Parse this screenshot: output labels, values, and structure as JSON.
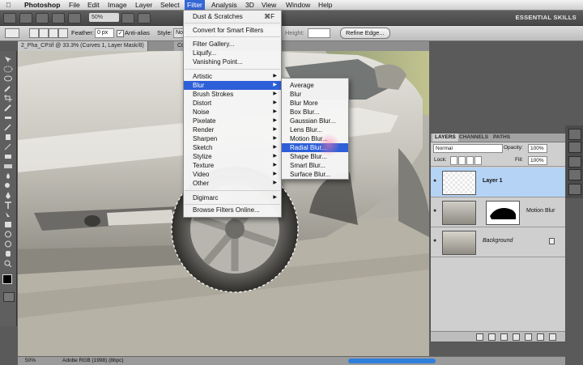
{
  "menubar": {
    "apple": "",
    "items": [
      "Photoshop",
      "File",
      "Edit",
      "Image",
      "Layer",
      "Select",
      "Filter",
      "Analysis",
      "3D",
      "View",
      "Window",
      "Help"
    ],
    "active": "Filter"
  },
  "appbar": {
    "zoom": "50%",
    "workspace": "ESSENTIAL SKILLS"
  },
  "options": {
    "feather_label": "Feather:",
    "feather_value": "0 px",
    "antialias_label": "Anti-alias",
    "antialias_check": "✓",
    "style_label": "Style:",
    "style_value": "Nor",
    "height_label": "Height:",
    "refine_edge": "Refine Edge..."
  },
  "document": {
    "tab_title": "2_Pha_CP.tif @ 33.3% (Curves 1, Layer Mask/8)",
    "tab2_title": "Cor"
  },
  "filter_menu": {
    "items": [
      {
        "label": "Dust & Scratches",
        "shortcut": "⌘F"
      },
      {
        "label": "Convert for Smart Filters"
      },
      {
        "label": "Filter Gallery..."
      },
      {
        "label": "Liquify..."
      },
      {
        "label": "Vanishing Point..."
      },
      {
        "label": "Artistic",
        "submenu": true
      },
      {
        "label": "Blur",
        "submenu": true,
        "highlighted": true
      },
      {
        "label": "Brush Strokes",
        "submenu": true
      },
      {
        "label": "Distort",
        "submenu": true
      },
      {
        "label": "Noise",
        "submenu": true
      },
      {
        "label": "Pixelate",
        "submenu": true
      },
      {
        "label": "Render",
        "submenu": true
      },
      {
        "label": "Sharpen",
        "submenu": true
      },
      {
        "label": "Sketch",
        "submenu": true
      },
      {
        "label": "Stylize",
        "submenu": true
      },
      {
        "label": "Texture",
        "submenu": true
      },
      {
        "label": "Video",
        "submenu": true
      },
      {
        "label": "Other",
        "submenu": true
      },
      {
        "label": "Digimarc",
        "submenu": true
      },
      {
        "label": "Browse Filters Online..."
      }
    ],
    "arrow": "▶"
  },
  "blur_menu": {
    "items": [
      {
        "label": "Average"
      },
      {
        "label": "Blur"
      },
      {
        "label": "Blur More"
      },
      {
        "label": "Box Blur..."
      },
      {
        "label": "Gaussian Blur..."
      },
      {
        "label": "Lens Blur..."
      },
      {
        "label": "Motion Blur..."
      },
      {
        "label": "Radial Blur...",
        "highlighted": true
      },
      {
        "label": "Shape Blur..."
      },
      {
        "label": "Smart Blur..."
      },
      {
        "label": "Surface Blur..."
      }
    ]
  },
  "layers_panel": {
    "tabs": [
      "LAYERS",
      "CHANNELS",
      "PATHS"
    ],
    "active_tab": "LAYERS",
    "blend_mode": "Normal",
    "opacity_label": "Opacity:",
    "opacity_value": "100%",
    "lock_label": "Lock:",
    "fill_label": "Fill:",
    "fill_value": "100%",
    "layers": [
      {
        "name": "Layer 1",
        "selected": true
      },
      {
        "name": "Motion Blur",
        "has_mask": true
      },
      {
        "name": "Background",
        "locked": true
      }
    ]
  },
  "status": {
    "zoom": "50%",
    "profile": "Adobe RGB (1998) (8bpc)"
  },
  "colors": {
    "menu_highlight": "#2d5fd8",
    "layer_selected": "#b5d4f5"
  }
}
